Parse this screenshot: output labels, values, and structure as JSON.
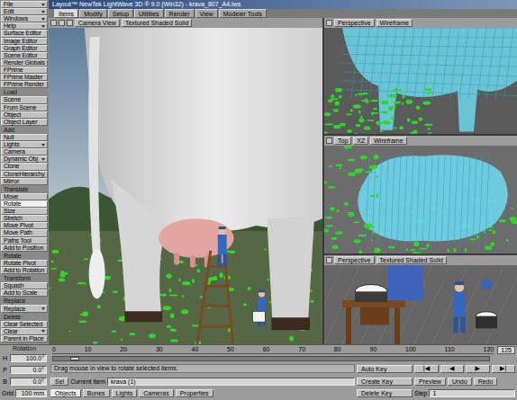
{
  "window": {
    "title": "Layout™ NewTek LightWave 3D ® 9.0 (Win32) - krava_807_A4.lws"
  },
  "tabs": [
    {
      "label": "Items",
      "selected": true
    },
    {
      "label": "Modify",
      "selected": false
    },
    {
      "label": "Setup",
      "selected": false
    },
    {
      "label": "Utilities",
      "selected": false
    },
    {
      "label": "Render",
      "selected": false
    },
    {
      "label": "View",
      "selected": false
    },
    {
      "label": "Modeler Tools",
      "selected": false
    }
  ],
  "toolbar": [
    {
      "kind": "menu",
      "label": "File",
      "selected": false
    },
    {
      "kind": "menu",
      "label": "Edit",
      "selected": false
    },
    {
      "kind": "menu",
      "label": "Windows",
      "selected": false
    },
    {
      "kind": "menu",
      "label": "Help",
      "selected": false
    },
    {
      "kind": "button",
      "label": "Surface Editor",
      "selected": false
    },
    {
      "kind": "button",
      "label": "Image Editor",
      "selected": false
    },
    {
      "kind": "button",
      "label": "Graph Editor",
      "selected": false
    },
    {
      "kind": "button",
      "label": "Scene Editor",
      "selected": false
    },
    {
      "kind": "button",
      "label": "Render Globals",
      "selected": false
    },
    {
      "kind": "button",
      "label": "FPrime",
      "selected": false
    },
    {
      "kind": "button",
      "label": "FPrime Master",
      "selected": false
    },
    {
      "kind": "button",
      "label": "FPrime Render",
      "selected": false
    },
    {
      "kind": "header",
      "label": "Load",
      "selected": false
    },
    {
      "kind": "button",
      "label": "Scene",
      "selected": false
    },
    {
      "kind": "button",
      "label": "From Scene",
      "selected": false
    },
    {
      "kind": "button",
      "label": "Object",
      "selected": false
    },
    {
      "kind": "button",
      "label": "Object Layer",
      "selected": false
    },
    {
      "kind": "header",
      "label": "Add",
      "selected": false
    },
    {
      "kind": "button",
      "label": "Null",
      "selected": false
    },
    {
      "kind": "menu",
      "label": "Lights",
      "selected": false
    },
    {
      "kind": "button",
      "label": "Camera",
      "selected": false
    },
    {
      "kind": "menu",
      "label": "Dynamic Obj",
      "selected": false
    },
    {
      "kind": "button",
      "label": "Clone",
      "selected": false
    },
    {
      "kind": "button",
      "label": "CloneHierarchy",
      "selected": false
    },
    {
      "kind": "button",
      "label": "Mirror",
      "selected": false
    },
    {
      "kind": "header",
      "label": "Translate",
      "selected": false
    },
    {
      "kind": "button",
      "label": "Move",
      "selected": false
    },
    {
      "kind": "button",
      "label": "Rotate",
      "selected": true
    },
    {
      "kind": "button",
      "label": "Size",
      "selected": false
    },
    {
      "kind": "button",
      "label": "Stretch",
      "selected": false
    },
    {
      "kind": "button",
      "label": "Move Pivot",
      "selected": false
    },
    {
      "kind": "button",
      "label": "Move Path",
      "selected": false
    },
    {
      "kind": "button",
      "label": "Paths Tool",
      "selected": false
    },
    {
      "kind": "button",
      "label": "Add to Position",
      "selected": false
    },
    {
      "kind": "header",
      "label": "Rotate",
      "selected": false
    },
    {
      "kind": "button",
      "label": "Rotate Pivot",
      "selected": false
    },
    {
      "kind": "button",
      "label": "Add to Rotation",
      "selected": false
    },
    {
      "kind": "header",
      "label": "Transform",
      "selected": false
    },
    {
      "kind": "button",
      "label": "Squash",
      "selected": false
    },
    {
      "kind": "button",
      "label": "Add to Scale",
      "selected": false
    },
    {
      "kind": "header",
      "label": "Replace",
      "selected": false
    },
    {
      "kind": "menu",
      "label": "Replace",
      "selected": false
    },
    {
      "kind": "header",
      "label": "Delete",
      "selected": false
    },
    {
      "kind": "button",
      "label": "Clear Selected",
      "selected": false
    },
    {
      "kind": "menu",
      "label": "Clear",
      "selected": false
    },
    {
      "kind": "button",
      "label": "Parent in Place",
      "selected": false
    }
  ],
  "viewports": [
    {
      "kind": "camera",
      "view": "Camera View",
      "mode": "Textured Shaded Solid"
    },
    {
      "kind": "wire-side",
      "view": "Perspective",
      "mode": "Wireframe"
    },
    {
      "kind": "wire-top",
      "view": "Top",
      "axis": "XZ",
      "mode": "Wireframe"
    },
    {
      "kind": "solid",
      "view": "Perspective",
      "mode": "Textured Shaded Solid"
    }
  ],
  "rotation": {
    "label": "Rotation",
    "fields": [
      {
        "axis": "H",
        "value": "100.0°"
      },
      {
        "axis": "P",
        "value": "0.0°"
      },
      {
        "axis": "B",
        "value": "0.0°"
      }
    ]
  },
  "grid": {
    "label": "Grid",
    "value": "100 mm"
  },
  "timeline": {
    "ticks": [
      "0",
      "10",
      "20",
      "30",
      "40",
      "50",
      "60",
      "70",
      "80",
      "90",
      "100",
      "110",
      "120"
    ],
    "end": "125",
    "level": 0.04
  },
  "status": {
    "message": "Drag mouse in view to rotate selected items.",
    "sel_label": "Sel",
    "item_label": "Current Item",
    "item": "krava (1)"
  },
  "item_types": [
    {
      "label": "Objects",
      "selected": true
    },
    {
      "label": "Bones",
      "selected": false
    },
    {
      "label": "Lights",
      "selected": false
    },
    {
      "label": "Cameras",
      "selected": false
    },
    {
      "label": "Properties",
      "selected": false
    }
  ],
  "keys": [
    "Auto Key",
    "Create Key",
    "Delete Key"
  ],
  "transport": [
    "|◀",
    "◀",
    "▶",
    "▶|"
  ],
  "playback": {
    "preview": "Preview",
    "undo": "Undo",
    "redo": "Redo",
    "step": "Step",
    "step_value": "1"
  }
}
